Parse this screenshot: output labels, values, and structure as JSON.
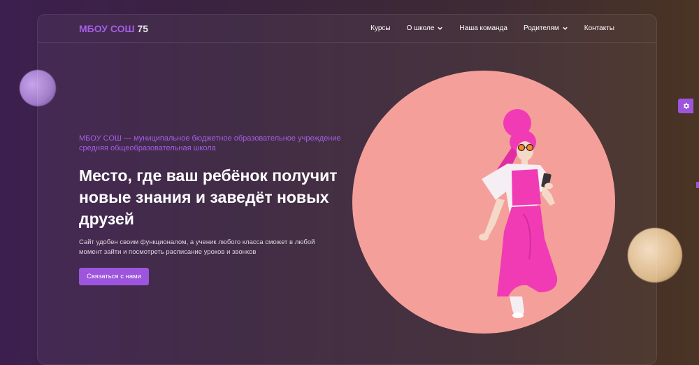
{
  "navbar": {
    "logo_text": "МБОУ СОШ ",
    "logo_number": "75",
    "links": [
      {
        "label": "Курсы",
        "dropdown": false
      },
      {
        "label": "О школе",
        "dropdown": true
      },
      {
        "label": "Наша команда",
        "dropdown": false
      },
      {
        "label": "Родителям",
        "dropdown": true
      },
      {
        "label": "Контакты",
        "dropdown": false
      }
    ]
  },
  "hero": {
    "subtitle": "МБОУ СОШ — муниципальное бюджетное образовательное учреждение средняя общеобразовательная школа",
    "headline": "Место, где ваш ребёнок получит новые знания и заведёт новых друзей",
    "description": "Сайт удобен своим функционалом, а ученик любого класса сможет в любой момент зайти и посмотреть расписание уроков и звонков",
    "cta_label": "Связаться с нами",
    "illustration": "girl-with-phone-illustration"
  },
  "settings": {
    "icon": "gear-icon"
  },
  "colors": {
    "accent": "#9d55dd",
    "logo": "#a45ee6",
    "circle": "#f59f9a",
    "figure": "#f03bb5"
  }
}
